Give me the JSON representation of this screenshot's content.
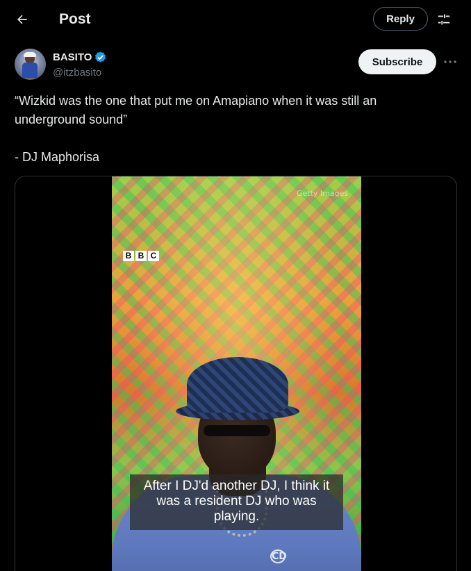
{
  "header": {
    "title": "Post",
    "reply_label": "Reply",
    "back_icon": "arrow-left-icon",
    "settings_icon": "sliders-icon"
  },
  "author": {
    "name": "BASITO",
    "handle": "@itzbasito",
    "verified_icon": "verified-badge-icon",
    "verified_color": "#1d9bf0",
    "subscribe_label": "Subscribe",
    "more_icon": "more-dots-icon"
  },
  "post": {
    "lines": [
      "“Wizkid was the one that put me on Amapiano when it was still an",
      "underground sound”",
      "- DJ Maphorisa"
    ]
  },
  "media": {
    "watermark": "Getty Images",
    "broadcaster_logo": [
      "B",
      "B",
      "C"
    ],
    "shirt_logo": "CD",
    "caption": "After I DJ'd another DJ, I think it was a resident DJ who was playing."
  },
  "colors": {
    "background": "#000000",
    "text": "#e7e9ea",
    "muted": "#71767b",
    "border": "#2f3336",
    "accent": "#1d9bf0"
  }
}
